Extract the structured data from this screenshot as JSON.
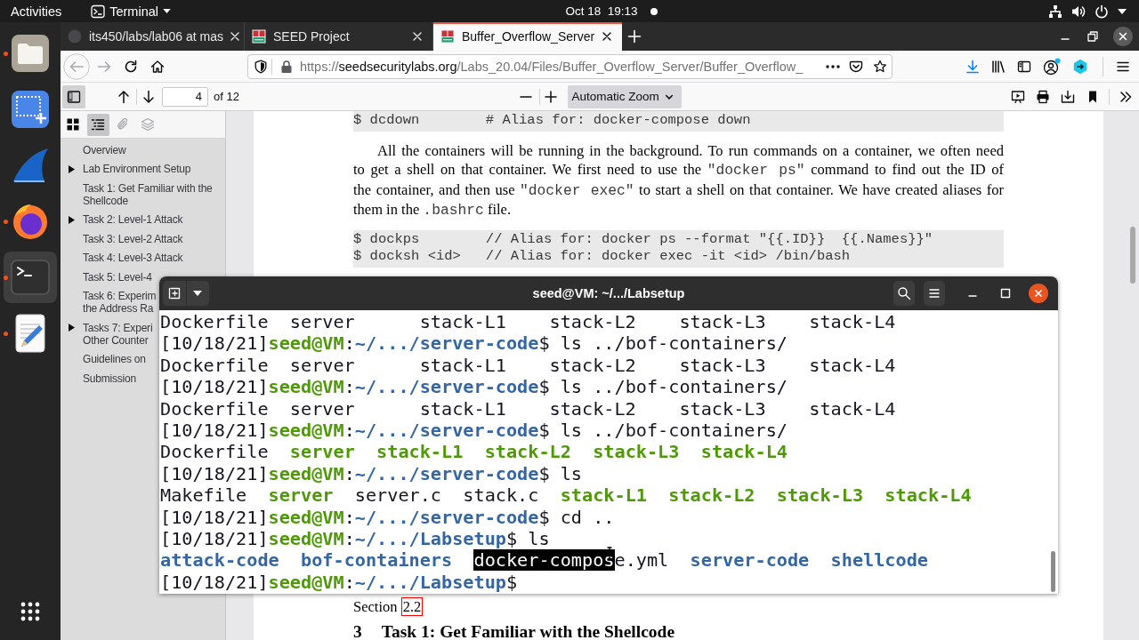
{
  "top_bar": {
    "activities": "Activities",
    "app_menu": "Terminal",
    "clock": "Oct 18  19:13",
    "notification": true
  },
  "dock": [
    {
      "kind": "files",
      "running": true,
      "focused": false
    },
    {
      "kind": "screenshot",
      "running": false,
      "focused": false
    },
    {
      "kind": "fin",
      "running": false,
      "focused": false
    },
    {
      "kind": "browser",
      "running": true,
      "focused": false
    },
    {
      "kind": "terminal",
      "running": true,
      "focused": true
    },
    {
      "kind": "editor",
      "running": true,
      "focused": false
    }
  ],
  "browser": {
    "tabs": [
      {
        "title": "its450/labs/lab06 at mas",
        "kind": "circle",
        "selected": false
      },
      {
        "title": "SEED Project",
        "kind": "blocks",
        "selected": false
      },
      {
        "title": "Buffer_Overflow_Server",
        "kind": "blocks",
        "selected": true
      }
    ],
    "navigation": {
      "back": {
        "disabled": true
      },
      "forward": {
        "disabled": true
      }
    },
    "url": {
      "scheme": "https://",
      "host": "seedsecuritylabs.org",
      "path": "/Labs_20.04/Files/Buffer_Overflow_Server/Buffer_Overflow_"
    },
    "pdf_toolbar": {
      "sidebar_open": true,
      "page": "4",
      "page_count": "of 12",
      "zoom": "Automatic Zoom"
    },
    "pdf_sidebar": {
      "views": [
        {
          "kind": "thumbnails",
          "selected": false,
          "disabled": false
        },
        {
          "kind": "outline",
          "selected": true,
          "disabled": false
        },
        {
          "kind": "attachments",
          "selected": false,
          "disabled": true
        },
        {
          "kind": "layers",
          "selected": false,
          "disabled": true
        }
      ],
      "outline": [
        {
          "label": "Overview",
          "kind": "leaf"
        },
        {
          "label": "Lab Environment Setup",
          "kind": "branch",
          "expanded": false
        },
        {
          "label": "Task 1: Get Familiar with the\nShellcode",
          "kind": "leaf"
        },
        {
          "label": "Task 2: Level-1 Attack",
          "kind": "branch",
          "expanded": false
        },
        {
          "label": "Task 3: Level-2 Attack",
          "kind": "leaf"
        },
        {
          "label": "Task 4: Level-3 Attack",
          "kind": "leaf"
        },
        {
          "label": "Task 5: Level-4",
          "kind": "leaf"
        },
        {
          "label": "Task 6: Experim\nthe Address Ra",
          "kind": "leaf"
        },
        {
          "label": "Tasks 7: Experi\nOther Counter",
          "kind": "branch",
          "expanded": false
        },
        {
          "label": "Guidelines on",
          "kind": "leaf"
        },
        {
          "label": "Submission",
          "kind": "leaf"
        }
      ]
    },
    "document": {
      "top_blocks": [
        {
          "kind": "code",
          "lines": [
            "$ dcdown        # Alias for: docker-compose down"
          ]
        },
        {
          "kind": "paragraph",
          "indented": true,
          "lines": [
            [
              {
                "kind": "roman",
                "text": "All the containers will be running in the background. To run commands on a container, we often need"
              }
            ],
            [
              {
                "kind": "roman",
                "text": "to get a shell on that container. We first need to use the "
              },
              {
                "kind": "mono",
                "text": "\"docker ps\""
              },
              {
                "kind": "roman",
                "text": " command to find out the ID of"
              }
            ],
            [
              {
                "kind": "roman",
                "text": "the container, and then use "
              },
              {
                "kind": "mono",
                "text": "\"docker exec\""
              },
              {
                "kind": "roman",
                "text": " to start a shell on that container. We have created aliases for"
              }
            ],
            [
              {
                "kind": "roman",
                "text": "them in the "
              },
              {
                "kind": "mono",
                "text": ".bashrc"
              },
              {
                "kind": "roman",
                "text": " file."
              }
            ]
          ]
        },
        {
          "kind": "code",
          "lines": [
            "$ dockps        // Alias for: docker ps --format \"{{.ID}}  {{.Names}}\"",
            "$ docksh <id>   // Alias for: docker exec -it <id> /bin/bash"
          ]
        }
      ],
      "bottom_blocks": [
        {
          "kind": "paragraph",
          "indented": false,
          "lines": [
            [
              {
                "kind": "roman",
                "text": "Section "
              },
              {
                "kind": "link",
                "text": "2.2"
              }
            ]
          ]
        },
        {
          "kind": "heading",
          "number": "3",
          "title": "Task 1: Get Familiar with the Shellcode"
        }
      ]
    }
  },
  "terminal": {
    "title": "seed@VM: ~/.../Labsetup",
    "lines": [
      [
        {
          "kind": "plain",
          "text": "Dockerfile  server      stack-L1    stack-L2    stack-L3    stack-L4"
        }
      ],
      [
        {
          "kind": "plain",
          "text": "[10/18/21]"
        },
        {
          "kind": "host",
          "text": "seed@VM"
        },
        {
          "kind": "plain",
          "text": ":"
        },
        {
          "kind": "path",
          "text": "~/.../server-code"
        },
        {
          "kind": "plain",
          "text": "$ ls ../bof-containers/"
        }
      ],
      [
        {
          "kind": "plain",
          "text": "Dockerfile  server      stack-L1    stack-L2    stack-L3    stack-L4"
        }
      ],
      [
        {
          "kind": "plain",
          "text": "[10/18/21]"
        },
        {
          "kind": "host",
          "text": "seed@VM"
        },
        {
          "kind": "plain",
          "text": ":"
        },
        {
          "kind": "path",
          "text": "~/.../server-code"
        },
        {
          "kind": "plain",
          "text": "$ ls ../bof-containers/"
        }
      ],
      [
        {
          "kind": "plain",
          "text": "Dockerfile  server      stack-L1    stack-L2    stack-L3    stack-L4"
        }
      ],
      [
        {
          "kind": "plain",
          "text": "[10/18/21]"
        },
        {
          "kind": "host",
          "text": "seed@VM"
        },
        {
          "kind": "plain",
          "text": ":"
        },
        {
          "kind": "path",
          "text": "~/.../server-code"
        },
        {
          "kind": "plain",
          "text": "$ ls ../bof-containers/"
        }
      ],
      [
        {
          "kind": "plain",
          "text": "Dockerfile  "
        },
        {
          "kind": "exec",
          "text": "server  "
        },
        {
          "kind": "exec",
          "text": "stack-L1  "
        },
        {
          "kind": "exec",
          "text": "stack-L2  "
        },
        {
          "kind": "exec",
          "text": "stack-L3  "
        },
        {
          "kind": "exec",
          "text": "stack-L4"
        }
      ],
      [
        {
          "kind": "plain",
          "text": "[10/18/21]"
        },
        {
          "kind": "host",
          "text": "seed@VM"
        },
        {
          "kind": "plain",
          "text": ":"
        },
        {
          "kind": "path",
          "text": "~/.../server-code"
        },
        {
          "kind": "plain",
          "text": "$ ls"
        }
      ],
      [
        {
          "kind": "plain",
          "text": "Makefile  "
        },
        {
          "kind": "exec",
          "text": "server  "
        },
        {
          "kind": "plain",
          "text": "server.c  stack.c  "
        },
        {
          "kind": "exec",
          "text": "stack-L1  "
        },
        {
          "kind": "exec",
          "text": "stack-L2  "
        },
        {
          "kind": "exec",
          "text": "stack-L3  "
        },
        {
          "kind": "exec",
          "text": "stack-L4"
        }
      ],
      [
        {
          "kind": "plain",
          "text": "[10/18/21]"
        },
        {
          "kind": "host",
          "text": "seed@VM"
        },
        {
          "kind": "plain",
          "text": ":"
        },
        {
          "kind": "path",
          "text": "~/.../server-code"
        },
        {
          "kind": "plain",
          "text": "$ cd .."
        }
      ],
      [
        {
          "kind": "plain",
          "text": "[10/18/21]"
        },
        {
          "kind": "host",
          "text": "seed@VM"
        },
        {
          "kind": "plain",
          "text": ":"
        },
        {
          "kind": "path",
          "text": "~/.../Labsetup"
        },
        {
          "kind": "plain",
          "text": "$ ls"
        }
      ],
      [
        {
          "kind": "dir",
          "text": "attack-code  "
        },
        {
          "kind": "dir",
          "text": "bof-containers  "
        },
        {
          "kind": "selection",
          "text": "docker-compos"
        },
        {
          "kind": "plain",
          "text": "e.yml  "
        },
        {
          "kind": "dir",
          "text": "server-code  "
        },
        {
          "kind": "dir",
          "text": "shellcode"
        }
      ],
      [
        {
          "kind": "plain",
          "text": "[10/18/21]"
        },
        {
          "kind": "host",
          "text": "seed@VM"
        },
        {
          "kind": "plain",
          "text": ":"
        },
        {
          "kind": "path",
          "text": "~/.../Labsetup"
        },
        {
          "kind": "plain",
          "text": "$"
        }
      ]
    ]
  }
}
